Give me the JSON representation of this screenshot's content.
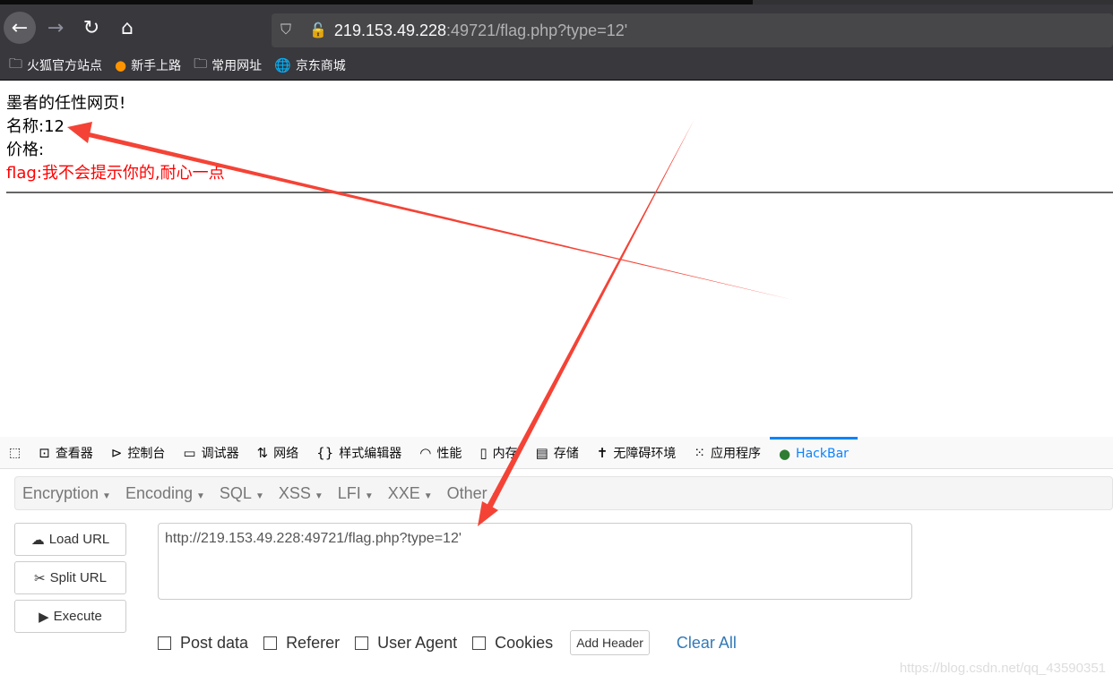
{
  "browser": {
    "url_host": "219.153.49.228",
    "url_rest": ":49721/flag.php?type=12'",
    "bookmarks": [
      {
        "label": "火狐官方站点",
        "icon": "folder-icon"
      },
      {
        "label": "新手上路",
        "icon": "firefox-icon"
      },
      {
        "label": "常用网址",
        "icon": "folder-icon"
      },
      {
        "label": "京东商城",
        "icon": "globe-icon"
      }
    ]
  },
  "page": {
    "line1": "墨者的任性网页!",
    "line2": "名称:12",
    "line3": "价格:",
    "line4": "flag:我不会提示你的,耐心一点"
  },
  "devtools": {
    "tabs": [
      "查看器",
      "控制台",
      "调试器",
      "网络",
      "样式编辑器",
      "性能",
      "内存",
      "存储",
      "无障碍环境",
      "应用程序",
      "HackBar"
    ]
  },
  "hackbar": {
    "menus": [
      "Encryption",
      "Encoding",
      "SQL",
      "XSS",
      "LFI",
      "XXE",
      "Other"
    ],
    "load_url": "Load URL",
    "split_url": "Split URL",
    "execute": "Execute",
    "url_value": "http://219.153.49.228:49721/flag.php?type=12'",
    "options": [
      "Post data",
      "Referer",
      "User Agent",
      "Cookies"
    ],
    "add_header": "Add Header",
    "clear_all": "Clear All"
  },
  "watermark": "https://blog.csdn.net/qq_43590351",
  "annotation_color": "#f44336"
}
